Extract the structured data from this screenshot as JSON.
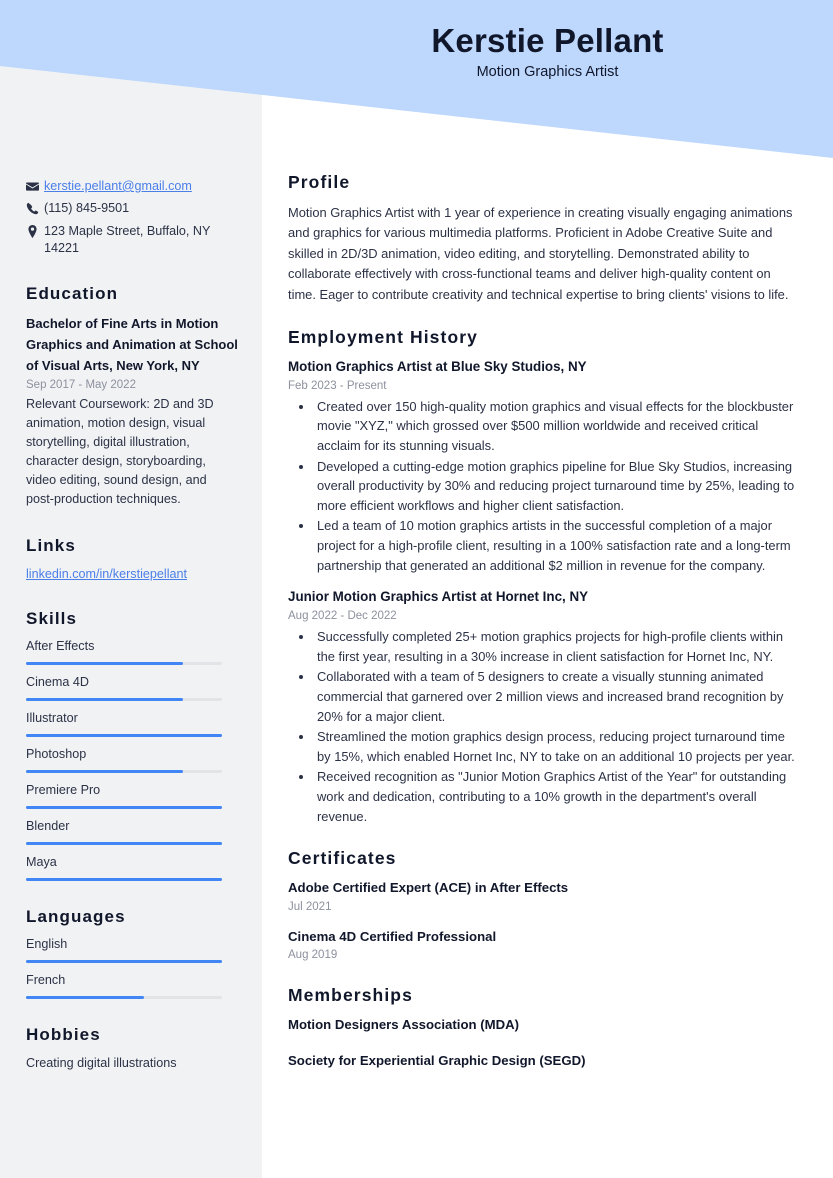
{
  "theme": {
    "banner_color": "#BDD7FD",
    "sidebar_color": "#F1F2F4",
    "accent_color": "#4285F4",
    "link_color": "#4A7FE8",
    "text_color": "#2C3246",
    "heading_color": "#11172B",
    "muted_color": "#8C919E"
  },
  "header": {
    "name": "Kerstie Pellant",
    "title": "Motion Graphics Artist"
  },
  "contact": {
    "email": "kerstie.pellant@gmail.com",
    "phone": "(115) 845-9501",
    "address": "123 Maple Street, Buffalo, NY 14221",
    "icons": {
      "email": "envelope-icon",
      "phone": "phone-icon",
      "address": "location-pin-icon"
    }
  },
  "education": {
    "heading": "Education",
    "entries": [
      {
        "degree": "Bachelor of Fine Arts in Motion Graphics and Animation at School of Visual Arts, New York, NY",
        "date": "Sep 2017 - May 2022",
        "description": "Relevant Coursework: 2D and 3D animation, motion design, visual storytelling, digital illustration, character design, storyboarding, video editing, sound design, and post-production techniques."
      }
    ]
  },
  "links": {
    "heading": "Links",
    "items": [
      {
        "label": "linkedin.com/in/kerstiepellant"
      }
    ]
  },
  "skills": {
    "heading": "Skills",
    "items": [
      {
        "label": "After Effects",
        "level": 80
      },
      {
        "label": "Cinema 4D",
        "level": 80
      },
      {
        "label": "Illustrator",
        "level": 100
      },
      {
        "label": "Photoshop",
        "level": 80
      },
      {
        "label": "Premiere Pro",
        "level": 100
      },
      {
        "label": "Blender",
        "level": 100
      },
      {
        "label": "Maya",
        "level": 100
      }
    ]
  },
  "languages": {
    "heading": "Languages",
    "items": [
      {
        "label": "English",
        "level": 100
      },
      {
        "label": "French",
        "level": 60
      }
    ]
  },
  "hobbies": {
    "heading": "Hobbies",
    "text": "Creating digital illustrations"
  },
  "profile": {
    "heading": "Profile",
    "text": "Motion Graphics Artist with 1 year of experience in creating visually engaging animations and graphics for various multimedia platforms. Proficient in Adobe Creative Suite and skilled in 2D/3D animation, video editing, and storytelling. Demonstrated ability to collaborate effectively with cross-functional teams and deliver high-quality content on time. Eager to contribute creativity and technical expertise to bring clients' visions to life."
  },
  "employment": {
    "heading": "Employment History",
    "jobs": [
      {
        "title": "Motion Graphics Artist at Blue Sky Studios, NY",
        "date": "Feb 2023 - Present",
        "bullets": [
          "Created over 150 high-quality motion graphics and visual effects for the blockbuster movie \"XYZ,\" which grossed over $500 million worldwide and received critical acclaim for its stunning visuals.",
          "Developed a cutting-edge motion graphics pipeline for Blue Sky Studios, increasing overall productivity by 30% and reducing project turnaround time by 25%, leading to more efficient workflows and higher client satisfaction.",
          "Led a team of 10 motion graphics artists in the successful completion of a major project for a high-profile client, resulting in a 100% satisfaction rate and a long-term partnership that generated an additional $2 million in revenue for the company."
        ]
      },
      {
        "title": "Junior Motion Graphics Artist at Hornet Inc, NY",
        "date": "Aug 2022 - Dec 2022",
        "bullets": [
          "Successfully completed 25+ motion graphics projects for high-profile clients within the first year, resulting in a 30% increase in client satisfaction for Hornet Inc, NY.",
          "Collaborated with a team of 5 designers to create a visually stunning animated commercial that garnered over 2 million views and increased brand recognition by 20% for a major client.",
          "Streamlined the motion graphics design process, reducing project turnaround time by 15%, which enabled Hornet Inc, NY to take on an additional 10 projects per year.",
          "Received recognition as \"Junior Motion Graphics Artist of the Year\" for outstanding work and dedication, contributing to a 10% growth in the department's overall revenue."
        ]
      }
    ]
  },
  "certificates": {
    "heading": "Certificates",
    "items": [
      {
        "title": "Adobe Certified Expert (ACE) in After Effects",
        "date": "Jul 2021"
      },
      {
        "title": "Cinema 4D Certified Professional",
        "date": "Aug 2019"
      }
    ]
  },
  "memberships": {
    "heading": "Memberships",
    "items": [
      {
        "title": "Motion Designers Association (MDA)"
      },
      {
        "title": "Society for Experiential Graphic Design (SEGD)"
      }
    ]
  }
}
